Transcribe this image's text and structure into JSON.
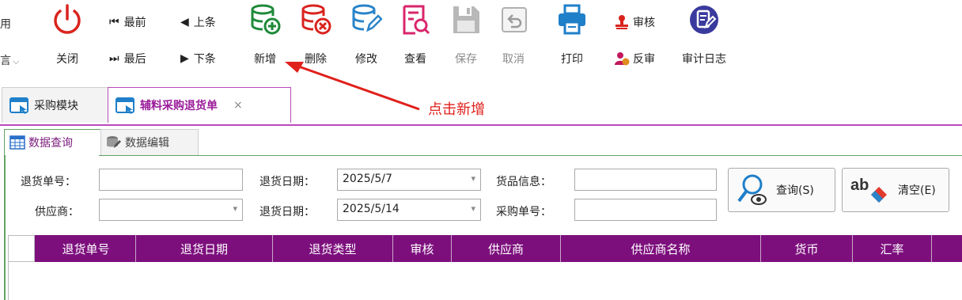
{
  "toolbar": {
    "edge_top": "用",
    "edge_bottom": "言",
    "close_label": "关闭",
    "first_label": "最前",
    "prev_label": "上条",
    "last_label": "最后",
    "next_label": "下条",
    "new_label": "新增",
    "delete_label": "删除",
    "edit_label": "修改",
    "view_label": "查看",
    "save_label": "保存",
    "cancel_label": "取消",
    "print_label": "打印",
    "approve_label": "审核",
    "unapprove_label": "反审",
    "audit_log_label": "审计日志"
  },
  "tabs": {
    "module_tab": "采购模块",
    "active_tab": "辅料采购退货单",
    "close_glyph": "×"
  },
  "annotation": {
    "callout_text": "点击新增",
    "color": "#e0201b"
  },
  "subtabs": {
    "query_tab": "数据查询",
    "edit_tab": "数据编辑"
  },
  "form": {
    "return_no_label": "退货单号：",
    "return_no_value": "",
    "supplier_label": "供应商：",
    "supplier_value": "",
    "date_from_label": "退货日期：",
    "date_from_value": "2025/5/7",
    "date_to_label": "退货日期：",
    "date_to_value": "2025/5/14",
    "goods_label": "货品信息：",
    "goods_value": "",
    "purchase_no_label": "采购单号：",
    "purchase_no_value": "",
    "query_button": "查询(S)",
    "clear_button": "清空(E)"
  },
  "grid": {
    "columns": [
      "退货单号",
      "退货日期",
      "退货类型",
      "审核",
      "供应商",
      "供应商名称",
      "货币",
      "汇率"
    ],
    "header_color": "#7d0f7d"
  },
  "colors": {
    "accent_purple": "#b94ab9",
    "accent_green": "#63a363"
  }
}
